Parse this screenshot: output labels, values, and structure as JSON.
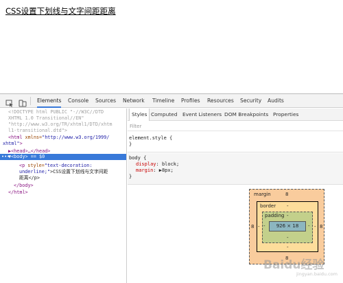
{
  "page": {
    "text": "CSS设置下划线与文字间距距离"
  },
  "devtools": {
    "tabs": [
      "Elements",
      "Console",
      "Sources",
      "Network",
      "Timeline",
      "Profiles",
      "Resources",
      "Security",
      "Audits"
    ],
    "active_tab": "Elements",
    "dom": {
      "doctype_1": "<!DOCTYPE html PUBLIC \"-//W3C//DTD",
      "doctype_2": "XHTML 1.0 Transitional//EN\"",
      "doctype_3": "\"http://www.w3.org/TR/xhtml1/DTD/xhtm",
      "doctype_4": "l1-transitional.dtd\">",
      "html_open_tag": "<html",
      "html_attr": " xmlns=",
      "html_attr_val": "\"http://www.w3.org/1999/",
      "html_attr_val_2": "xhtml\"",
      "html_close_bracket": ">",
      "head_line": "▶<head>…</head>",
      "body_line": "▼<body> == $0",
      "body_marker": "•••",
      "p_tag": "<p",
      "p_attr": " style=",
      "p_val_1": "\"text-decoration:",
      "p_val_2": "underline;\"",
      "p_text": ">CSS设置下划线与文字间距",
      "p_text_2": "距离</p>",
      "body_close": "</body>",
      "html_close": "</html>"
    },
    "styles": {
      "subtabs": [
        "Styles",
        "Computed",
        "Event Listeners",
        "DOM Breakpoints",
        "Properties"
      ],
      "active_subtab": "Styles",
      "filter_placeholder": "Filter",
      "element_style_selector": "element.style {",
      "element_style_close": "}",
      "body_selector": "body {",
      "prop1_name": "display",
      "prop1_value": ": block;",
      "prop2_name": "margin",
      "prop2_value": ": ▶8px;",
      "body_close": "}"
    },
    "box_model": {
      "margin_label": "margin",
      "margin_top": "8",
      "margin_left": "8",
      "margin_right": "8",
      "margin_bottom": "8",
      "border_label": "border",
      "border_top": "-",
      "border_left": "-",
      "border_right": "-",
      "border_bottom": "-",
      "padding_label": "padding",
      "padding_top": "-",
      "padding_left": "-",
      "padding_right": "-",
      "padding_bottom": "-",
      "content": "926 × 18"
    }
  },
  "watermark": {
    "text": "Baidu经验",
    "sub": "jingyan.baidu.com"
  },
  "colors": {
    "selection": "#3879d9",
    "tag": "#881280",
    "attr": "#994500",
    "value": "#1a1aa6",
    "css_prop": "#c80000"
  }
}
